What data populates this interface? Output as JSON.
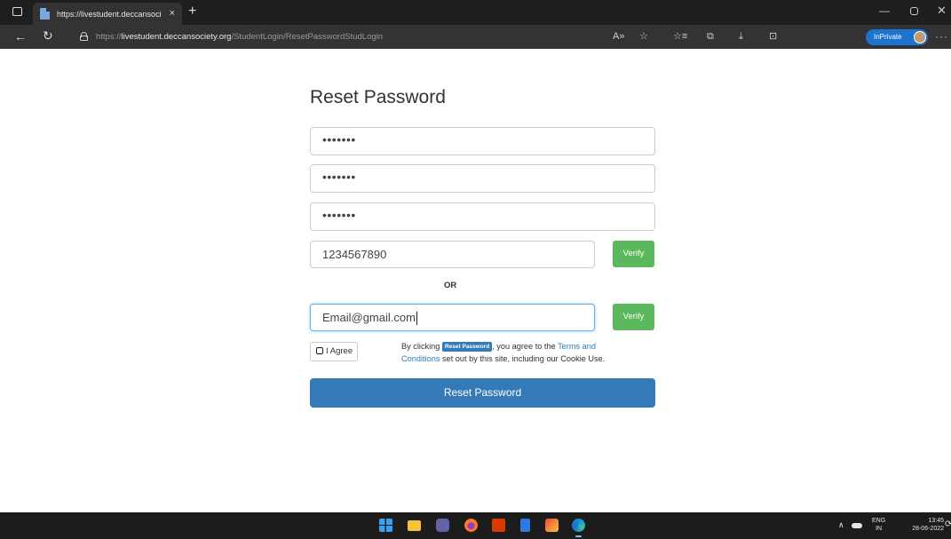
{
  "browser": {
    "tab_title": "https://livestudent.deccansociety",
    "tab_close": "×",
    "new_tab": "+",
    "url_scheme": "https://",
    "url_host": "livestudent.deccansociety.org",
    "url_path": "/StudentLogin/ResetPasswordStudLogin",
    "inprivate_label": "InPrivate"
  },
  "form": {
    "title": "Reset Password",
    "field1_value": "•••••••",
    "field2_value": "•••••••",
    "field3_value": "•••••••",
    "phone_value": "1234567890",
    "verify_label": "Verify",
    "or_label": "OR",
    "email_value": "Email@gmail.com",
    "agree_label": "I Agree",
    "terms_prefix": "By clicking",
    "terms_badge": "Reset Password",
    "terms_middle": ", you agree to the",
    "terms_link1": "Terms and Conditions",
    "terms_suffix": "set out by this site, including our Cookie Use.",
    "submit_label": "Reset Password"
  },
  "taskbar": {
    "lang_top": "ENG",
    "lang_bottom": "IN",
    "time": "13:45",
    "date": "28-06-2022"
  },
  "icons": [
    "start-icon",
    "file-explorer-icon",
    "teams-icon",
    "firefox-icon",
    "office-icon",
    "notepad-icon",
    "wordart-icon",
    "edge-icon"
  ]
}
